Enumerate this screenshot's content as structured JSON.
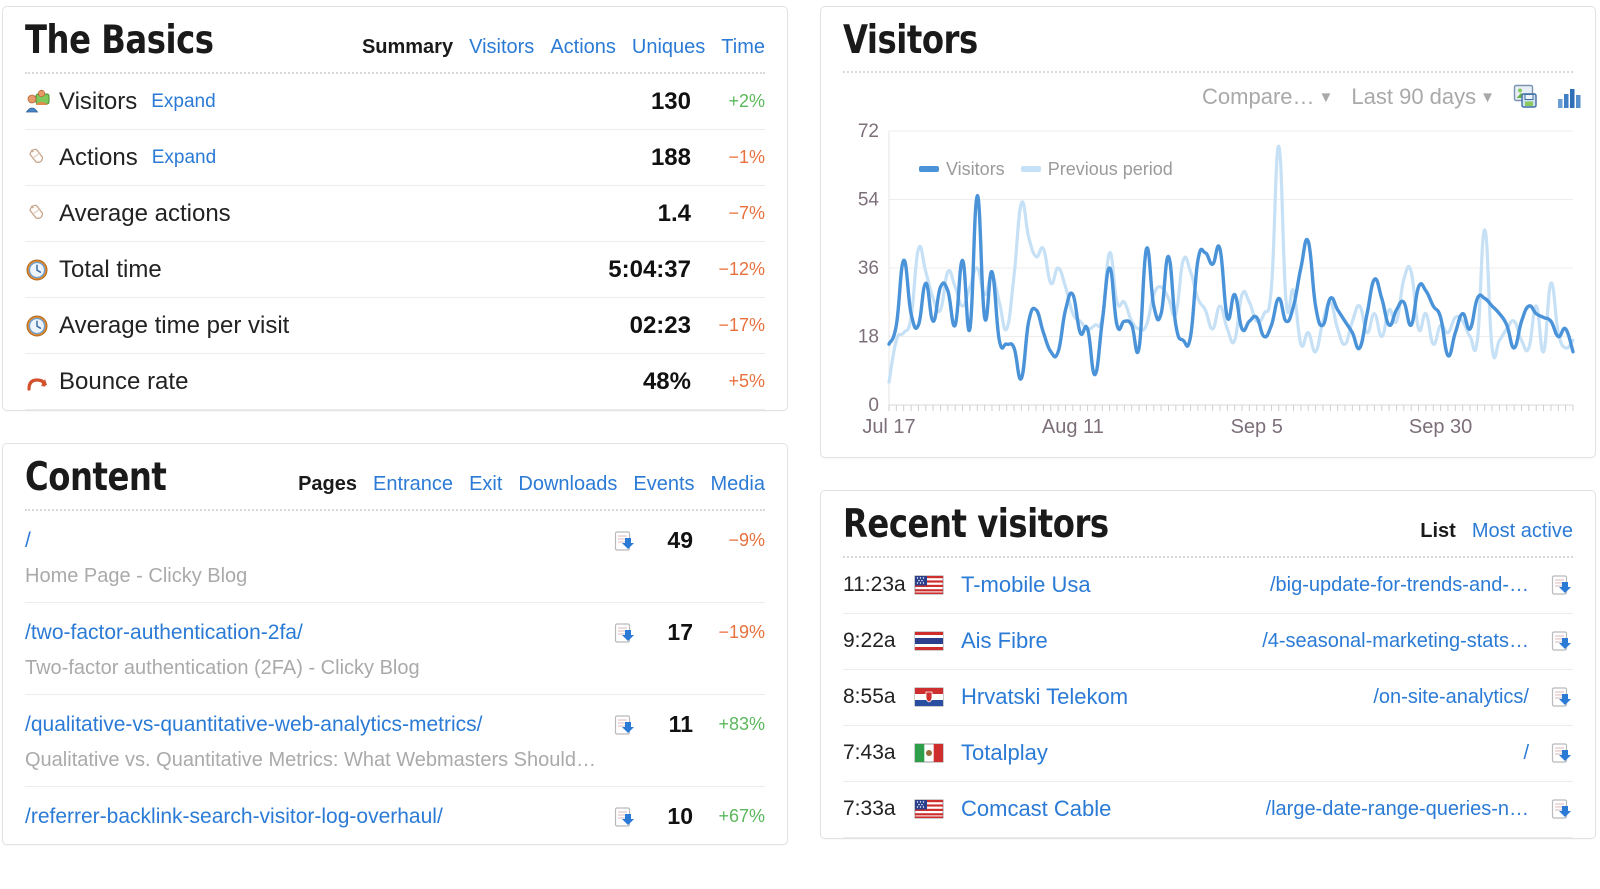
{
  "basics": {
    "title": "The Basics",
    "subnav": [
      {
        "label": "Summary",
        "active": true
      },
      {
        "label": "Visitors",
        "active": false
      },
      {
        "label": "Actions",
        "active": false
      },
      {
        "label": "Uniques",
        "active": false
      },
      {
        "label": "Time",
        "active": false
      }
    ],
    "rows": [
      {
        "icon": "visitors-icon",
        "label": "Visitors",
        "expand": "Expand",
        "value": "130",
        "delta": "+2%",
        "dir": "up"
      },
      {
        "icon": "actions-icon",
        "label": "Actions",
        "expand": "Expand",
        "value": "188",
        "delta": "−1%",
        "dir": "down"
      },
      {
        "icon": "actions-icon",
        "label": "Average actions",
        "expand": "",
        "value": "1.4",
        "delta": "−7%",
        "dir": "down"
      },
      {
        "icon": "clock-icon",
        "label": "Total time",
        "expand": "",
        "value": "5:04:37",
        "delta": "−12%",
        "dir": "down"
      },
      {
        "icon": "clock-icon",
        "label": "Average time per visit",
        "expand": "",
        "value": "02:23",
        "delta": "−17%",
        "dir": "down"
      },
      {
        "icon": "bounce-icon",
        "label": "Bounce rate",
        "expand": "",
        "value": "48%",
        "delta": "+5%",
        "dir": "down"
      }
    ]
  },
  "content": {
    "title": "Content",
    "subnav": [
      {
        "label": "Pages",
        "active": true
      },
      {
        "label": "Entrance",
        "active": false
      },
      {
        "label": "Exit",
        "active": false
      },
      {
        "label": "Downloads",
        "active": false
      },
      {
        "label": "Events",
        "active": false
      },
      {
        "label": "Media",
        "active": false
      }
    ],
    "items": [
      {
        "url": "/",
        "title": "Home Page - Clicky Blog",
        "value": "49",
        "delta": "−9%",
        "dir": "down"
      },
      {
        "url": "/two-factor-authentication-2fa/",
        "title": "Two-factor authentication (2FA) - Clicky Blog",
        "value": "17",
        "delta": "−19%",
        "dir": "down"
      },
      {
        "url": "/qualitative-vs-quantitative-web-analytics-metrics/",
        "title": "Qualitative vs. Quantitative Metrics: What Webmasters Should…",
        "value": "11",
        "delta": "+83%",
        "dir": "up"
      },
      {
        "url": "/referrer-backlink-search-visitor-log-overhaul/",
        "title": "",
        "value": "10",
        "delta": "+67%",
        "dir": "up"
      }
    ]
  },
  "visitors_panel": {
    "title": "Visitors",
    "toolbar": {
      "compare_label": "Compare…",
      "range_label": "Last 90 days",
      "caret": "▼",
      "save_icon": "save-image-icon",
      "chart_type_icon": "bar-chart-icon"
    }
  },
  "recent": {
    "title": "Recent visitors",
    "subnav": [
      {
        "label": "List",
        "active": true
      },
      {
        "label": "Most active",
        "active": false
      }
    ],
    "rows": [
      {
        "time": "11:23a",
        "flag": "us-flag-icon",
        "name": "T-mobile Usa",
        "path": "/big-update-for-trends-and-…",
        "icon": "page-icon"
      },
      {
        "time": "9:22a",
        "flag": "th-flag-icon",
        "name": "Ais Fibre",
        "path": "/4-seasonal-marketing-stats…",
        "icon": "page-icon"
      },
      {
        "time": "8:55a",
        "flag": "hr-flag-icon",
        "name": "Hrvatski Telekom",
        "path": "/on-site-analytics/",
        "icon": "page-icon"
      },
      {
        "time": "7:43a",
        "flag": "mx-flag-icon",
        "name": "Totalplay",
        "path": "/",
        "icon": "page-icon"
      },
      {
        "time": "7:33a",
        "flag": "us-flag-icon",
        "name": "Comcast Cable",
        "path": "/large-date-range-queries-n…",
        "icon": "page-icon"
      }
    ]
  },
  "colors": {
    "link": "#2b7bd6",
    "up": "#5cb85c",
    "down": "#e8713d",
    "series_current": "#4a93d9",
    "series_previous": "#c6e0f5",
    "axis_text": "#7d6f7a",
    "grid": "#ededed"
  },
  "chart_data": {
    "type": "line",
    "title": "Visitors",
    "xlabel": "",
    "ylabel": "",
    "ylim": [
      0,
      72
    ],
    "yticks": [
      0,
      18,
      36,
      54,
      72
    ],
    "xticks": [
      "Jul 17",
      "Aug 11",
      "Sep 5",
      "Sep 30"
    ],
    "xtick_positions": [
      0,
      25,
      50,
      75
    ],
    "grid": true,
    "legend_position": "top-left",
    "series": [
      {
        "name": "Visitors",
        "color": "#4a93d9",
        "values": [
          16,
          21,
          38,
          24,
          21,
          32,
          22,
          31,
          30,
          21,
          38,
          20,
          55,
          23,
          35,
          17,
          16,
          15,
          7,
          22,
          25,
          19,
          14,
          14,
          25,
          29,
          19,
          20,
          8,
          22,
          36,
          21,
          22,
          21,
          15,
          41,
          26,
          24,
          39,
          21,
          17,
          18,
          38,
          40,
          37,
          41,
          23,
          29,
          20,
          22,
          23,
          18,
          21,
          28,
          22,
          26,
          36,
          43,
          26,
          21,
          28,
          25,
          22,
          19,
          15,
          24,
          33,
          28,
          21,
          25,
          27,
          21,
          31,
          30,
          26,
          23,
          13,
          19,
          24,
          20,
          28,
          28,
          26,
          24,
          21,
          15,
          22,
          26,
          24,
          23,
          22,
          18,
          20,
          14
        ]
      },
      {
        "name": "Previous period",
        "color": "#c6e0f5",
        "values": [
          6,
          17,
          19,
          23,
          41,
          35,
          28,
          25,
          35,
          31,
          26,
          31,
          36,
          29,
          34,
          27,
          20,
          34,
          53,
          44,
          39,
          41,
          32,
          36,
          31,
          24,
          22,
          20,
          21,
          23,
          40,
          27,
          27,
          22,
          20,
          21,
          29,
          31,
          28,
          24,
          38,
          35,
          28,
          25,
          20,
          26,
          20,
          17,
          29,
          27,
          22,
          24,
          31,
          68,
          27,
          30,
          16,
          19,
          14,
          22,
          27,
          20,
          16,
          22,
          26,
          19,
          24,
          18,
          25,
          22,
          33,
          35,
          20,
          24,
          16,
          21,
          19,
          23,
          22,
          18,
          17,
          46,
          15,
          17,
          20,
          22,
          17,
          15,
          26,
          14,
          32,
          19,
          15,
          17
        ]
      }
    ]
  }
}
